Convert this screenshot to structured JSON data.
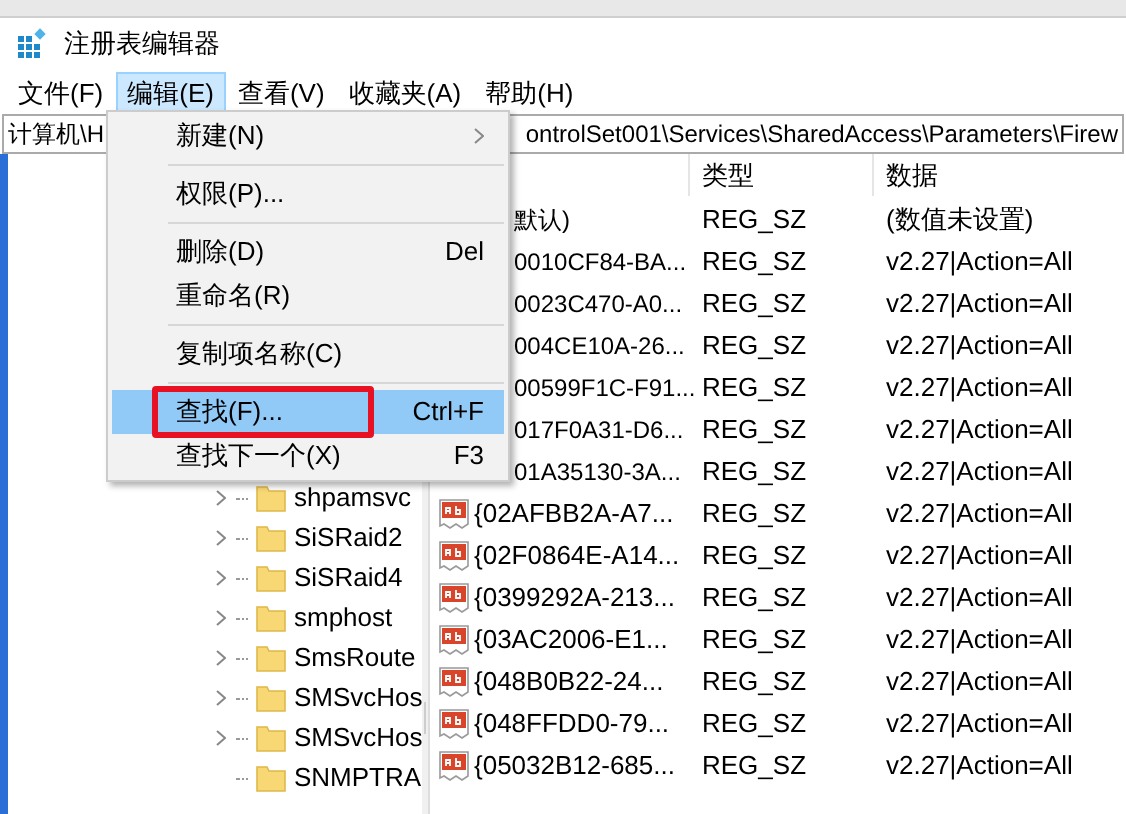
{
  "window": {
    "title": "注册表编辑器"
  },
  "menubar": [
    {
      "label": "文件(F)",
      "selected": false
    },
    {
      "label": "编辑(E)",
      "selected": true
    },
    {
      "label": "查看(V)",
      "selected": false
    },
    {
      "label": "收藏夹(A)",
      "selected": false
    },
    {
      "label": "帮助(H)",
      "selected": false
    }
  ],
  "address_bar": {
    "visible_start": "计算机\\H",
    "visible_end": "ontrolSet001\\Services\\SharedAccess\\Parameters\\Firew"
  },
  "tree": {
    "items": [
      {
        "label": "shpamsvc",
        "expandable": true
      },
      {
        "label": "SiSRaid2",
        "expandable": true
      },
      {
        "label": "SiSRaid4",
        "expandable": true
      },
      {
        "label": "smphost",
        "expandable": true
      },
      {
        "label": "SmsRoute",
        "expandable": true
      },
      {
        "label": "SMSvcHos",
        "expandable": true
      },
      {
        "label": "SMSvcHos",
        "expandable": true
      },
      {
        "label": "SNMPTRA",
        "expandable": false
      }
    ]
  },
  "table": {
    "columns": [
      "类型",
      "数据"
    ],
    "rows": [
      {
        "name": "默认)",
        "covered": true,
        "type": "REG_SZ",
        "data": "(数值未设置)"
      },
      {
        "name": "0010CF84-BA...",
        "covered": true,
        "type": "REG_SZ",
        "data": "v2.27|Action=All"
      },
      {
        "name": "0023C470-A0...",
        "covered": true,
        "type": "REG_SZ",
        "data": "v2.27|Action=All"
      },
      {
        "name": "004CE10A-26...",
        "covered": true,
        "type": "REG_SZ",
        "data": "v2.27|Action=All"
      },
      {
        "name": "00599F1C-F91...",
        "covered": true,
        "type": "REG_SZ",
        "data": "v2.27|Action=All"
      },
      {
        "name": "017F0A31-D6...",
        "covered": true,
        "type": "REG_SZ",
        "data": "v2.27|Action=All"
      },
      {
        "name": "01A35130-3A...",
        "covered": true,
        "type": "REG_SZ",
        "data": "v2.27|Action=All"
      },
      {
        "name": "{02AFBB2A-A7...",
        "covered": false,
        "type": "REG_SZ",
        "data": "v2.27|Action=All"
      },
      {
        "name": "{02F0864E-A14...",
        "covered": false,
        "type": "REG_SZ",
        "data": "v2.27|Action=All"
      },
      {
        "name": "{0399292A-213...",
        "covered": false,
        "type": "REG_SZ",
        "data": "v2.27|Action=All"
      },
      {
        "name": "{03AC2006-E1...",
        "covered": false,
        "type": "REG_SZ",
        "data": "v2.27|Action=All"
      },
      {
        "name": "{048B0B22-24...",
        "covered": false,
        "type": "REG_SZ",
        "data": "v2.27|Action=All"
      },
      {
        "name": "{048FFDD0-79...",
        "covered": false,
        "type": "REG_SZ",
        "data": "v2.27|Action=All"
      },
      {
        "name": "{05032B12-685...",
        "covered": false,
        "type": "REG_SZ",
        "data": "v2.27|Action=All"
      }
    ]
  },
  "edit_menu": {
    "items": [
      {
        "kind": "item",
        "label": "新建(N)",
        "submenu": true,
        "selected": false,
        "outlined": false
      },
      {
        "kind": "separator"
      },
      {
        "kind": "item",
        "label": "权限(P)...",
        "submenu": false,
        "selected": false,
        "outlined": false
      },
      {
        "kind": "separator"
      },
      {
        "kind": "item",
        "label": "删除(D)",
        "shortcut": "Del",
        "submenu": false,
        "selected": false,
        "outlined": false
      },
      {
        "kind": "item",
        "label": "重命名(R)",
        "submenu": false,
        "selected": false,
        "outlined": false
      },
      {
        "kind": "separator"
      },
      {
        "kind": "item",
        "label": "复制项名称(C)",
        "submenu": false,
        "selected": false,
        "outlined": false
      },
      {
        "kind": "separator"
      },
      {
        "kind": "item",
        "label": "查找(F)...",
        "shortcut": "Ctrl+F",
        "submenu": false,
        "selected": true,
        "outlined": true
      },
      {
        "kind": "item",
        "label": "查找下一个(X)",
        "shortcut": "F3",
        "submenu": false,
        "selected": false,
        "outlined": false
      }
    ]
  }
}
